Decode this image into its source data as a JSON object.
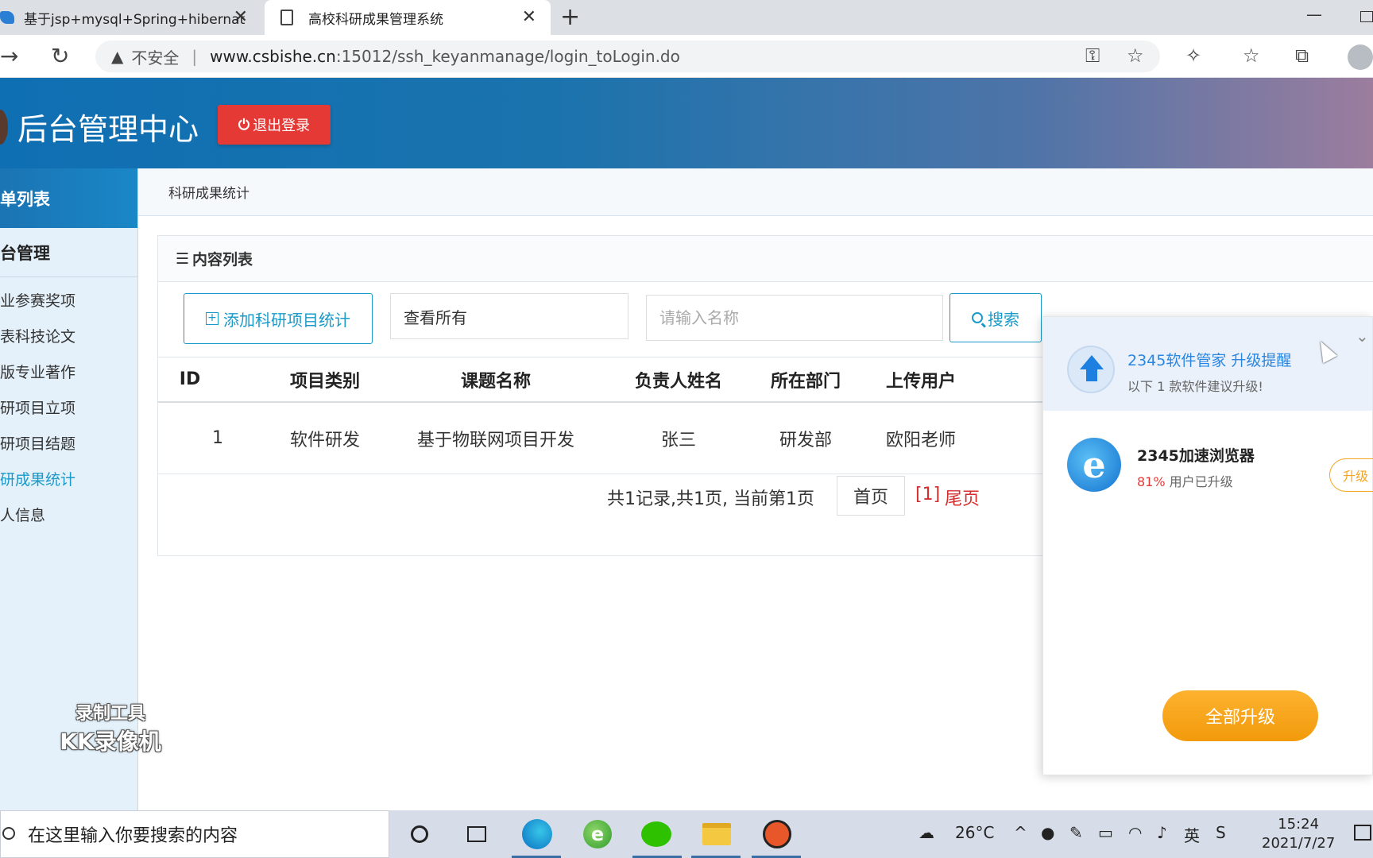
{
  "browser": {
    "tabs": [
      {
        "title": "基于jsp+mysql+Spring+hibernat",
        "close": "✕"
      },
      {
        "title": "高校科研成果管理系统",
        "close": "✕"
      }
    ],
    "new_tab": "+",
    "insecure_label": "不安全",
    "url_host": "www.csbishe.cn",
    "url_path": ":15012/ssh_keyanmanage/login_toLogin.do"
  },
  "header": {
    "title": "后台管理中心",
    "logout": "退出登录"
  },
  "sidebar": {
    "heading": "单列表",
    "group": "台管理",
    "items": [
      {
        "label": "业参赛奖项"
      },
      {
        "label": "表科技论文"
      },
      {
        "label": "版专业著作"
      },
      {
        "label": "研项目立项"
      },
      {
        "label": "研项目结题"
      },
      {
        "label": "研成果统计",
        "active": true
      },
      {
        "label": "人信息"
      }
    ]
  },
  "breadcrumb": "科研成果统计",
  "panel": {
    "title": "内容列表",
    "add_button": "添加科研项目统计",
    "select_value": "查看所有",
    "search_placeholder": "请输入名称",
    "search_button": "搜索"
  },
  "table": {
    "columns": [
      "ID",
      "项目类别",
      "课题名称",
      "负责人姓名",
      "所在部门",
      "上传用户"
    ],
    "rows": [
      [
        "1",
        "软件研发",
        "基于物联网项目开发",
        "张三",
        "研发部",
        "欧阳老师"
      ]
    ]
  },
  "pager": {
    "info": "共1记录,共1页, 当前第1页",
    "first": "首页",
    "current": "[1]",
    "last": "尾页"
  },
  "popup": {
    "title": "2345软件管家 升级提醒",
    "subtitle": "以下 1 款软件建议升级!",
    "app_name": "2345加速浏览器",
    "app_pct": "81%",
    "app_pct_text": " 用户已升级",
    "app_button": "升级",
    "upgrade_all": "全部升级"
  },
  "watermark": {
    "line1": "录制工具",
    "line2": "KK录像机"
  },
  "taskbar": {
    "search_placeholder": "在这里输入你要搜索的内容",
    "temperature": "26°C",
    "ime": "英",
    "time": "15:24",
    "date": "2021/7/27"
  },
  "colors": {
    "accent": "#1a9ac9",
    "logout": "#e53935",
    "pager_red": "#d32f2f",
    "popup_orange": "#f5a623"
  }
}
